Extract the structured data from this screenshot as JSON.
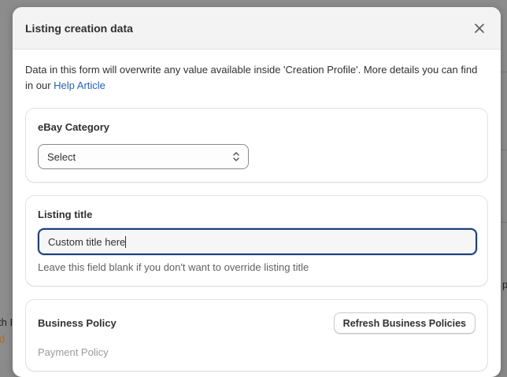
{
  "modal": {
    "title": "Listing creation data",
    "close_icon": "close-icon"
  },
  "intro": {
    "text": "Data in this form will overwrite any value available inside 'Creation Profile'. More details you can find in our ",
    "link_label": "Help Article"
  },
  "ebay_category": {
    "label": "eBay Category",
    "select_value": "Select",
    "select_icon": "select-arrows-icon"
  },
  "listing_title": {
    "label": "Listing title",
    "value": "Custom title here",
    "help": "Leave this field blank if you don't want to override listing title"
  },
  "business_policy": {
    "label": "Business Policy",
    "refresh_label": "Refresh Business Policies",
    "payment_label": "Payment Policy"
  },
  "background": {
    "text_left": "th I",
    "text_left_orange": "d",
    "text_right": "p"
  },
  "colors": {
    "link": "#2463bc",
    "focus_border": "#1f3f77",
    "header_bg": "#f3f3f3"
  }
}
